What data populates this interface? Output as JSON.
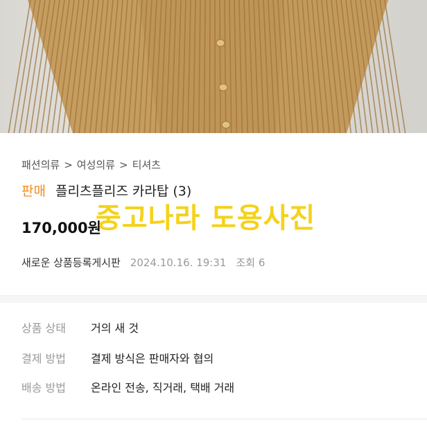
{
  "breadcrumb": [
    "패션의류",
    "여성의류",
    "티셔츠"
  ],
  "breadcrumb_separator": ">",
  "listing": {
    "status_badge": "판매",
    "title": "플리츠플리즈 카라탑 (3)",
    "price": "170,000원",
    "watermark": "중고나라 도용사진",
    "board": "새로운 상품등록게시판",
    "date": "2024.10.16. 19:31",
    "views_label": "조회",
    "views_count": "6"
  },
  "specs": [
    {
      "label": "상품 상태",
      "value": "거의 새 것"
    },
    {
      "label": "결제 방법",
      "value": "결제 방식은 판매자와 협의"
    },
    {
      "label": "배송 방법",
      "value": "온라인 전송, 직거래, 택배 거래"
    }
  ],
  "colors": {
    "badge": "#f08c1c",
    "watermark": "#f5d21a",
    "garment": "#c49a5c"
  }
}
